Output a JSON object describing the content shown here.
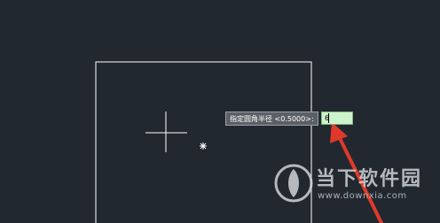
{
  "command_prompt": {
    "label": "指定圆角半径 <0.5000>:",
    "input_value": "6"
  },
  "watermark": {
    "title": "当下软件园",
    "url": "www.downxia.com"
  },
  "colors": {
    "canvas_background": "#212830",
    "rectangle_stroke": "#ffffff",
    "crosshair": "#ffffff",
    "input_background": "#cdf3cd",
    "arrow": "#e0392b"
  },
  "icons": {
    "crosshair": "crosshair-cursor-icon",
    "snap_marker": "snap-marker-icon",
    "annotation": "red-arrow-annotation"
  }
}
